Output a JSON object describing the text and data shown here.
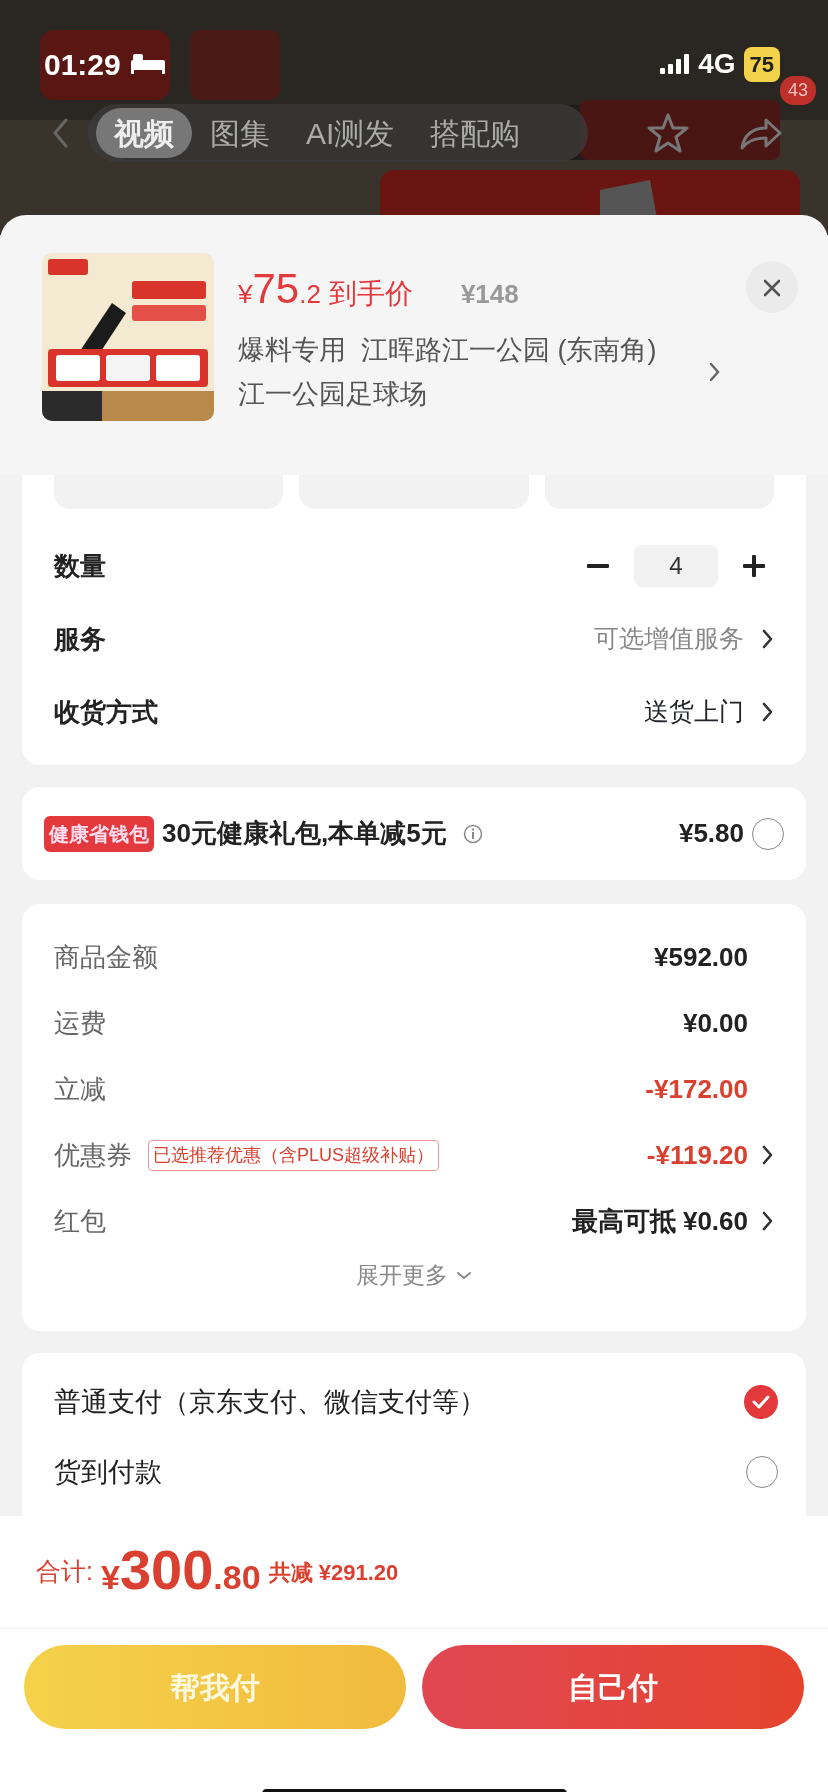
{
  "status_bar": {
    "time": "01:29",
    "network": "4G",
    "battery": "75"
  },
  "product_nav": {
    "tabs": [
      {
        "label": "视频",
        "selected": true
      },
      {
        "label": "图集",
        "selected": false
      },
      {
        "label": "AI测发",
        "selected": false
      },
      {
        "label": "搭配购",
        "selected": false
      }
    ],
    "badge": "43"
  },
  "product": {
    "price": {
      "symbol": "¥",
      "integer": "75",
      "decimal": ".2"
    },
    "price_label": "到手价",
    "original_price": "¥148",
    "address_lines": [
      "爆料专用  江晖路江一公园 (东南角)",
      "江一公园足球场"
    ]
  },
  "quantity": {
    "label": "数量",
    "value": "4"
  },
  "options": [
    {
      "label": "服务",
      "value": "可选增值服务",
      "muted": true
    },
    {
      "label": "收货方式",
      "value": "送货上门",
      "muted": false
    }
  ],
  "health_pack": {
    "tag": "健康省钱包",
    "text": "30元健康礼包,本单**减5元**",
    "amount": "¥5.80",
    "selected": false
  },
  "summary": {
    "rows": [
      {
        "label": "商品金额",
        "value": "¥592.00",
        "discount": false,
        "arrow": false
      },
      {
        "label": "运费",
        "value": "¥0.00",
        "discount": false,
        "arrow": false
      },
      {
        "label": "立减",
        "value": "-¥172.00",
        "discount": true,
        "arrow": false
      },
      {
        "label": "优惠券",
        "tag": "已选推荐优惠（含PLUS超级补贴）",
        "value": "-¥119.20",
        "discount": true,
        "arrow": true
      },
      {
        "label": "红包",
        "value": "最高可抵 ¥0.60",
        "discount": false,
        "arrow": true
      }
    ],
    "expand": "展开更多"
  },
  "payment_methods": [
    {
      "label": "普通支付（京东支付、微信支付等）",
      "selected": true
    },
    {
      "label": "货到付款",
      "selected": false
    }
  ],
  "total": {
    "label": "合计:",
    "amount": {
      "symbol": "¥",
      "integer": "300",
      "decimal": ".80"
    },
    "saving_label": "共减",
    "saving": "¥291.20"
  },
  "buttons": [
    {
      "label": "帮我付",
      "kind": "helper"
    },
    {
      "label": "自己付",
      "kind": "self"
    }
  ]
}
